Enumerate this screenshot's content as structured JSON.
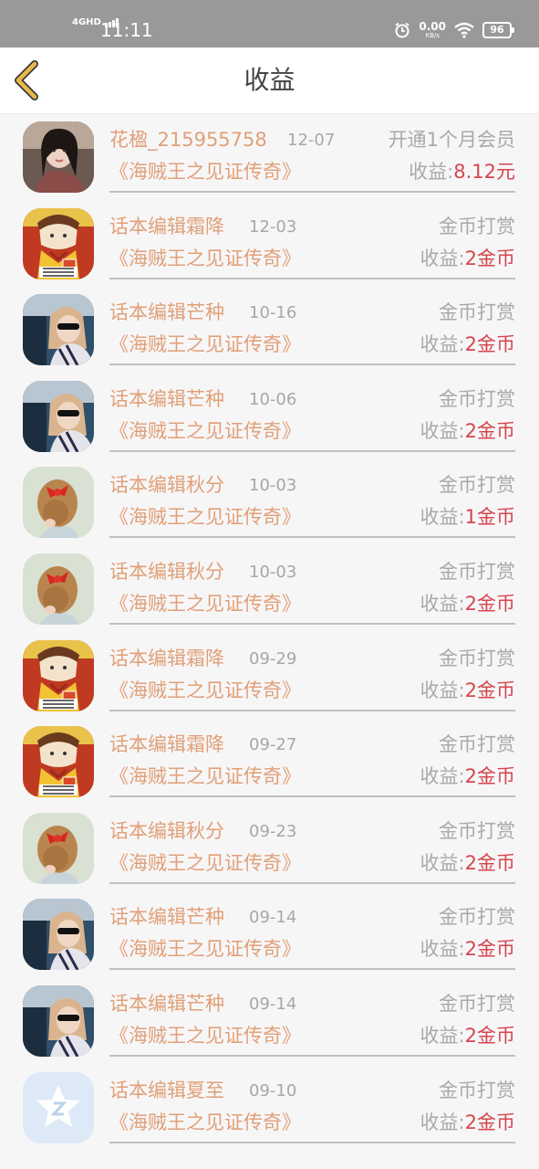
{
  "status_bar": {
    "network": "4GHD",
    "time": "11:11",
    "speed_value": "0.00",
    "speed_unit": "KB/s",
    "battery": "96"
  },
  "header": {
    "title": "收益"
  },
  "records": [
    {
      "name": "花楹_215955758",
      "date": "12-07",
      "type": "开通1个月会员",
      "book": "《海贼王之见证传奇》",
      "earn_label": "收益:",
      "earn_value": "8.12元",
      "avatar": "photo-girl"
    },
    {
      "name": "话本编辑霜降",
      "date": "12-03",
      "type": "金币打赏",
      "book": "《海贼王之见证传奇》",
      "earn_label": "收益:",
      "earn_value": "2金币",
      "avatar": "cartoon"
    },
    {
      "name": "话本编辑芒种",
      "date": "10-16",
      "type": "金币打赏",
      "book": "《海贼王之见证传奇》",
      "earn_label": "收益:",
      "earn_value": "2金币",
      "avatar": "car-girl"
    },
    {
      "name": "话本编辑芒种",
      "date": "10-06",
      "type": "金币打赏",
      "book": "《海贼王之见证传奇》",
      "earn_label": "收益:",
      "earn_value": "2金币",
      "avatar": "car-girl"
    },
    {
      "name": "话本编辑秋分",
      "date": "10-03",
      "type": "金币打赏",
      "book": "《海贼王之见证传奇》",
      "earn_label": "收益:",
      "earn_value": "1金币",
      "avatar": "bow-girl"
    },
    {
      "name": "话本编辑秋分",
      "date": "10-03",
      "type": "金币打赏",
      "book": "《海贼王之见证传奇》",
      "earn_label": "收益:",
      "earn_value": "2金币",
      "avatar": "bow-girl"
    },
    {
      "name": "话本编辑霜降",
      "date": "09-29",
      "type": "金币打赏",
      "book": "《海贼王之见证传奇》",
      "earn_label": "收益:",
      "earn_value": "2金币",
      "avatar": "cartoon"
    },
    {
      "name": "话本编辑霜降",
      "date": "09-27",
      "type": "金币打赏",
      "book": "《海贼王之见证传奇》",
      "earn_label": "收益:",
      "earn_value": "2金币",
      "avatar": "cartoon"
    },
    {
      "name": "话本编辑秋分",
      "date": "09-23",
      "type": "金币打赏",
      "book": "《海贼王之见证传奇》",
      "earn_label": "收益:",
      "earn_value": "2金币",
      "avatar": "bow-girl"
    },
    {
      "name": "话本编辑芒种",
      "date": "09-14",
      "type": "金币打赏",
      "book": "《海贼王之见证传奇》",
      "earn_label": "收益:",
      "earn_value": "2金币",
      "avatar": "car-girl"
    },
    {
      "name": "话本编辑芒种",
      "date": "09-14",
      "type": "金币打赏",
      "book": "《海贼王之见证传奇》",
      "earn_label": "收益:",
      "earn_value": "2金币",
      "avatar": "car-girl"
    },
    {
      "name": "话本编辑夏至",
      "date": "09-10",
      "type": "金币打赏",
      "book": "《海贼王之见证传奇》",
      "earn_label": "收益:",
      "earn_value": "2金币",
      "avatar": "default-star"
    }
  ],
  "colors": {
    "accent_orange": "#e0a078",
    "earn_red": "#d5454f",
    "muted_gray": "#a9a9a9",
    "back_arrow": "#e8b84a"
  }
}
